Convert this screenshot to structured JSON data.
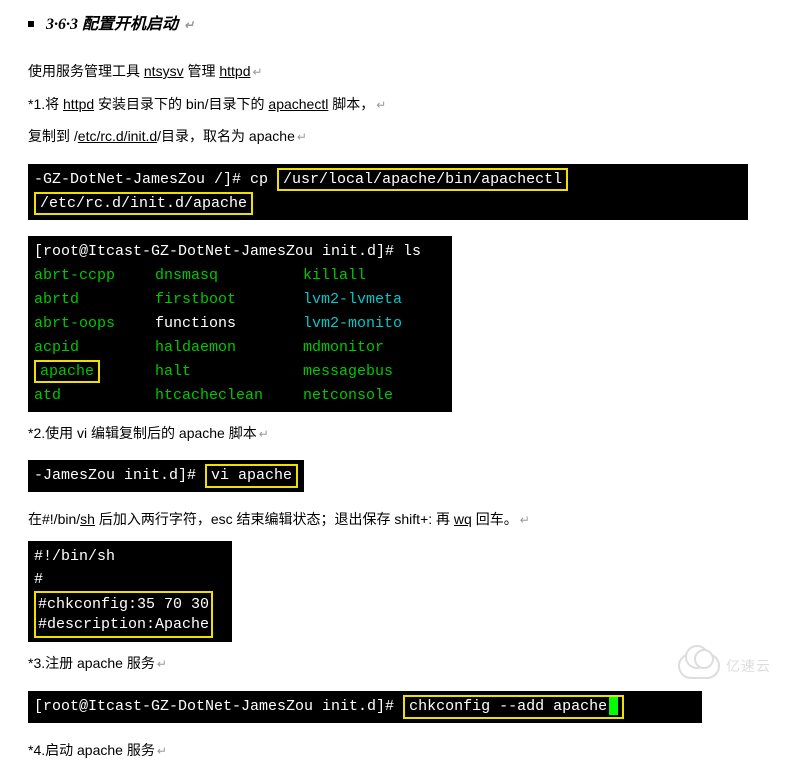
{
  "heading": "3·6·3 配置开机启动",
  "intro": {
    "p1_a": "使用服务管理工具 ",
    "p1_b": "ntsysv",
    "p1_c": " 管理 ",
    "p1_d": "httpd",
    "p2_a": "*1.将 ",
    "p2_b": "httpd",
    "p2_c": " 安装目录下的 bin/目录下的 ",
    "p2_d": "apachectl",
    "p2_e": "   脚本，",
    "p3_a": "复制到  /",
    "p3_b": "etc/rc.d/init.d",
    "p3_c": "/目录，取名为  apache"
  },
  "term1": {
    "prompt": "-GZ-DotNet-JamesZou /]# cp ",
    "path1": "/usr/local/apache/bin/apachectl",
    "path2": "/etc/rc.d/init.d/apache"
  },
  "term2": {
    "prompt": "[root@Itcast-GZ-DotNet-JamesZou init.d]# ls",
    "col1": [
      "abrt-ccpp",
      "abrtd",
      "abrt-oops",
      "acpid",
      "apache",
      "atd"
    ],
    "col2": [
      "dnsmasq",
      "firstboot",
      "functions",
      "haldaemon",
      "halt",
      "htcacheclean"
    ],
    "col3": [
      "killall",
      "lvm2-lvmeta",
      "lvm2-monito",
      "mdmonitor",
      "messagebus",
      "netconsole"
    ]
  },
  "p_step2": "*2.使用 vi 编辑复制后的 apache 脚本",
  "term3": {
    "prompt": "-JamesZou init.d]# ",
    "cmd": "vi  apache"
  },
  "p_sh_a": "在#!/bin/",
  "p_sh_b": "sh",
  "p_sh_c": "  后加入两行字符，esc 结束编辑状态；退出保存  shift+:    再 ",
  "p_sh_d": "wq",
  "p_sh_e": " 回车。",
  "term4": {
    "l1": "#!/bin/sh",
    "l2": "#",
    "l3": "#chkconfig:35 70 30",
    "l4": "#description:Apache"
  },
  "p_step3": "*3.注册 apache 服务",
  "term5": {
    "prompt": "[root@Itcast-GZ-DotNet-JamesZou init.d]# ",
    "cmd": "chkconfig --add apache"
  },
  "p_step4": "*4.启动 apache 服务",
  "watermark": "亿速云",
  "ret": "↵"
}
